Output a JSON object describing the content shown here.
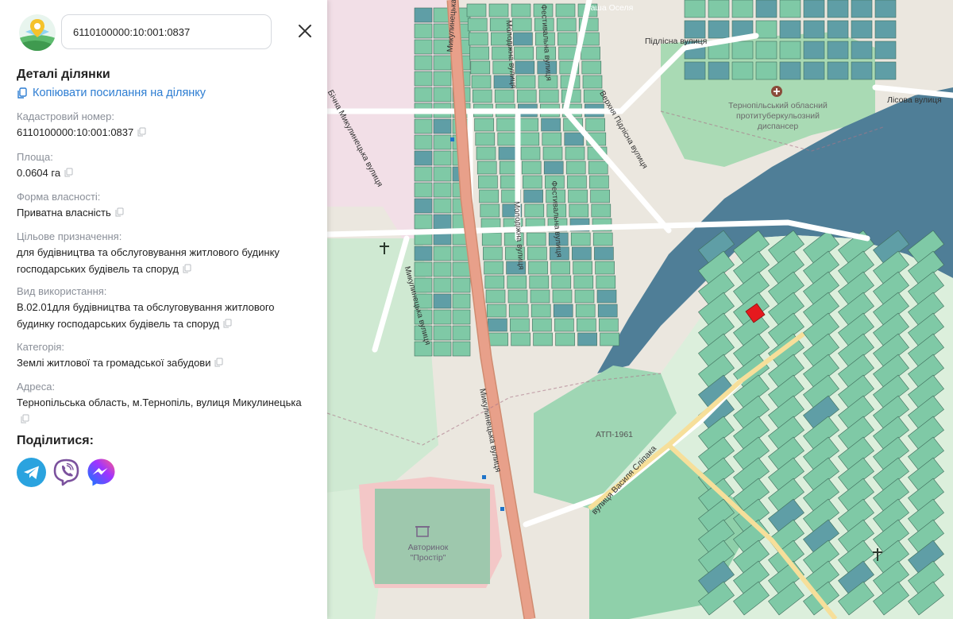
{
  "search": {
    "value": "6110100000:10:001:0837"
  },
  "details": {
    "title": "Деталі ділянки",
    "copy_link": "Копіювати посилання на ділянку",
    "fields": [
      {
        "label": "Кадастровий номер:",
        "value": "6110100000:10:001:0837"
      },
      {
        "label": "Площа:",
        "value": "0.0604 га"
      },
      {
        "label": "Форма власності:",
        "value": "Приватна власність"
      },
      {
        "label": "Цільове призначення:",
        "value": "для будівництва та обслуговування житлового будинку господарських будівель та споруд"
      },
      {
        "label": "Вид використання:",
        "value": "В.02.01для будівництва та обслуговування житлового будинку господарських будівель та споруд"
      },
      {
        "label": "Категорія:",
        "value": "Землі житлової та громадської забудови"
      },
      {
        "label": "Адреса:",
        "value": "Тернопільська область, м.Тернопіль, вулиця Микулинецька"
      }
    ],
    "share_title": "Поділитися:"
  },
  "map": {
    "labels": {
      "nasha_oselia": "Наша Оселя",
      "pidlisna": "Підлісна вулиця",
      "lisova": "Лісова вулиця",
      "hospital": "Тернопільський обласний протитуберкульозний диспансер",
      "bichna": "Бічна Микулинецька вулиця",
      "mykulynetska_top": "Микулинецька вулиця",
      "mykulynetska_bottom": "Микулинецька вулиця",
      "molodizhna_top": "Молодіжна вулиця",
      "molodizhna_mid": "Молодіжна вулиця",
      "festyvalna_top": "Фестивальна вулиця",
      "festyvalna_mid": "Фестивальна вулиця",
      "verkhnia_pidlisna": "Верхня Підлісна вулиця",
      "mykulynetska_left": "Микулинецька вулиця",
      "atp": "АТП-1961",
      "vasylia_stilpaka": "вулиця Василя Сліпака",
      "avtorynok": "Авторинок \"Простір\""
    },
    "colors": {
      "parcel": "#7fc9a6",
      "parcel_dark": "#5f9ea6",
      "water": "#4f7e97",
      "selected": "#e5191e",
      "road": "#e8a08a"
    }
  }
}
